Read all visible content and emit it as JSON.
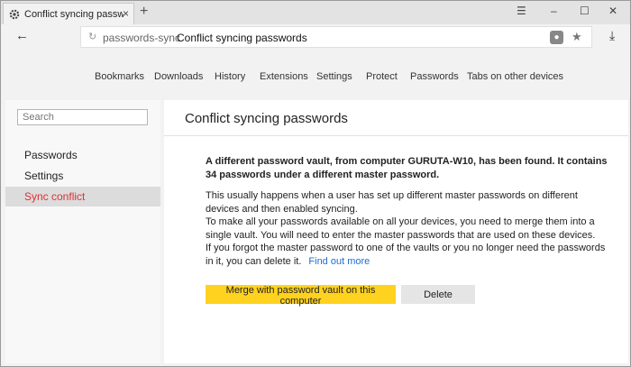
{
  "browser": {
    "tab_title": "Conflict syncing passwords",
    "tab_close": "×",
    "new_tab": "+",
    "win_minimize": "–",
    "win_restore": "☐",
    "win_close": "✕",
    "menu_icon": "☰"
  },
  "address": {
    "host": "passwords-sync",
    "title": "Conflict syncing passwords"
  },
  "nav": {
    "links": [
      "Bookmarks",
      "Downloads",
      "History",
      "Extensions",
      "Settings",
      "Protect",
      "Passwords",
      "Tabs on other devices"
    ]
  },
  "sidebar": {
    "search_placeholder": "Search",
    "items": [
      {
        "label": "Passwords",
        "active": false
      },
      {
        "label": "Settings",
        "active": false
      },
      {
        "label": "Sync conflict",
        "active": true
      }
    ]
  },
  "main": {
    "title": "Conflict syncing passwords",
    "lead": "A different password vault, from computer GURUTA-W10, has been found. It contains 34 passwords under a different master password.",
    "p1": "This usually happens when a user has set up different master passwords on different devices and then enabled syncing.",
    "p2": "To make all your passwords available on all your devices, you need to merge them into a single vault. You will need to enter the master passwords that are used on these devices.",
    "p3": "If you forgot the master password to one of the vaults or you no longer need the passwords in it, you can delete it.",
    "link": "Find out more",
    "primary_button": "Merge with password vault on this computer",
    "secondary_button": "Delete"
  },
  "colors": {
    "accent_active": "#e03030",
    "primary_button": "#ffd21f",
    "link": "#1a6fd6"
  }
}
